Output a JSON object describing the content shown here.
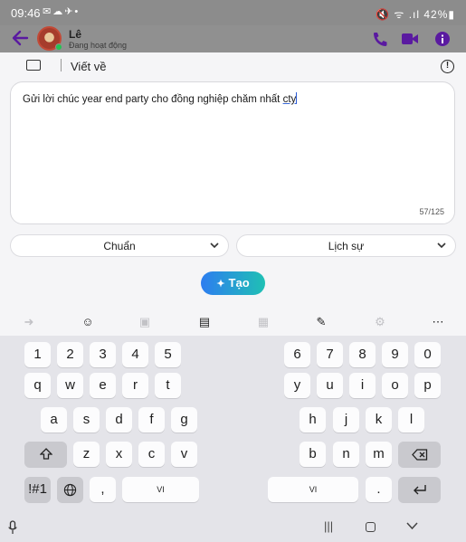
{
  "status_bar": {
    "time": "09:46",
    "notif_icons": "✉☁✈•",
    "system_right": "🔇 ᯤ .ıl 42%▮",
    "battery_percent": "42%"
  },
  "chat": {
    "contact_name": "Lê",
    "contact_status": "Đang hoạt động",
    "accent": "#6a1fb0"
  },
  "panel": {
    "title": "Viết về",
    "prompt_text_before": "Gửi lời chúc year end party cho đồng nghiệp chăm nhất ",
    "prompt_text_underlined": "cty",
    "char_count": "57/125",
    "tone_dropdown": "Chuẩn",
    "style_dropdown": "Lịch sự",
    "generate_label": "Tạo"
  },
  "toolbar": {
    "icons": [
      "arrow-right-icon",
      "emoji-icon",
      "sticker-icon",
      "clipboard-icon",
      "gif-icon",
      "handwriting-icon",
      "settings-icon",
      "more-icon"
    ]
  },
  "keyboard": {
    "left": {
      "row1": [
        "1",
        "2",
        "3",
        "4",
        "5"
      ],
      "row2": [
        "q",
        "w",
        "e",
        "r",
        "t"
      ],
      "row3": [
        "a",
        "s",
        "d",
        "f",
        "g"
      ],
      "row4": [
        "z",
        "x",
        "c",
        "v"
      ],
      "symbols": "!#1",
      "comma": ",",
      "space": "VI"
    },
    "right": {
      "row1": [
        "6",
        "7",
        "8",
        "9",
        "0"
      ],
      "row2": [
        "y",
        "u",
        "i",
        "o",
        "p"
      ],
      "row3": [
        "h",
        "j",
        "k",
        "l"
      ],
      "row4": [
        "b",
        "n",
        "m"
      ],
      "space": "VI",
      "period": "."
    }
  }
}
